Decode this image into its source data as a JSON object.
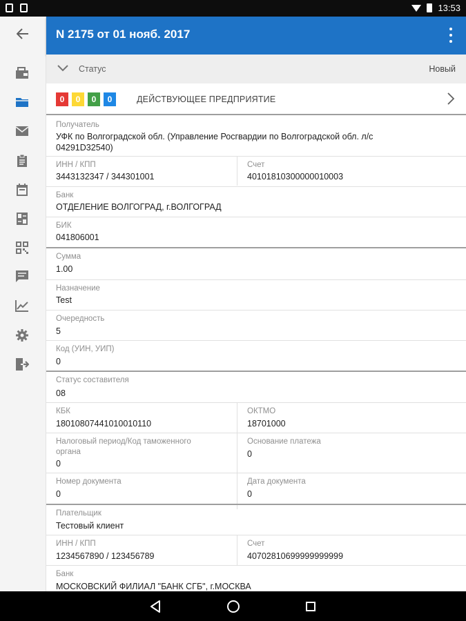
{
  "statusbar": {
    "time": "13:53"
  },
  "header": {
    "title": "N 2175 от 01 нояб. 2017"
  },
  "status": {
    "label": "Статус",
    "value": "Новый"
  },
  "counters": {
    "boxes": [
      {
        "value": "0",
        "color": "#e53935"
      },
      {
        "value": "0",
        "color": "#fdd835"
      },
      {
        "value": "0",
        "color": "#43a047"
      },
      {
        "value": "0",
        "color": "#1e88e5"
      }
    ],
    "label": "ДЕЙСТВУЮЩЕЕ ПРЕДПРИЯТИЕ"
  },
  "recipient": {
    "label": "Получатель",
    "value_line1": "УФК по Волгоградской обл. (Управление Росгвардии по Волгоградской обл. л/с",
    "value_line2": "04291D32540)",
    "inn_label": "ИНН / КПП",
    "inn_value": "3443132347 / 344301001",
    "account_label": "Счет",
    "account_value": "40101810300000010003",
    "bank_label": "Банк",
    "bank_value": "ОТДЕЛЕНИЕ ВОЛГОГРАД, г.ВОЛГОГРАД",
    "bik_label": "БИК",
    "bik_value": "041806001"
  },
  "payment": {
    "sum_label": "Сумма",
    "sum_value": "1.00",
    "purpose_label": "Назначение",
    "purpose_value": "Test",
    "order_label": "Очередность",
    "order_value": "5",
    "code_label": "Код (УИН, УИП)",
    "code_value": "0"
  },
  "tax": {
    "compiler_label": "Статус составителя",
    "compiler_value": "08",
    "kbk_label": "КБК",
    "kbk_value": "18010807441010010110",
    "oktmo_label": "ОКТМО",
    "oktmo_value": "18701000",
    "period_label_line1": "Налоговый период/Код таможенного",
    "period_label_line2": "органа",
    "period_value": "0",
    "basis_label": "Основание платежа",
    "basis_value": "0",
    "docnum_label": "Номер документа",
    "docnum_value": "0",
    "docdate_label": "Дата документа",
    "docdate_value": "0"
  },
  "payer": {
    "label": "Плательщик",
    "value": "Тестовый клиент",
    "inn_label": "ИНН / КПП",
    "inn_value": "1234567890 / 123456789",
    "account_label": "Счет",
    "account_value": "40702810699999999999",
    "bank_label": "Банк",
    "bank_value": "МОСКОВСКИЙ ФИЛИАЛ \"БАНК СГБ\", г.МОСКВА"
  },
  "icons": {
    "sidebar": [
      "back-arrow-icon",
      "wallet-icon",
      "folder-icon",
      "mail-icon",
      "clipboard-icon",
      "calendar-icon",
      "calculator-icon",
      "qr-code-icon",
      "chat-icon",
      "chart-icon",
      "gear-icon",
      "exit-icon"
    ],
    "nav": [
      "back-triangle-icon",
      "home-circle-icon",
      "recents-square-icon"
    ]
  },
  "colors": {
    "appbar": "#1e73c6",
    "active_icon": "#1e73c6"
  }
}
